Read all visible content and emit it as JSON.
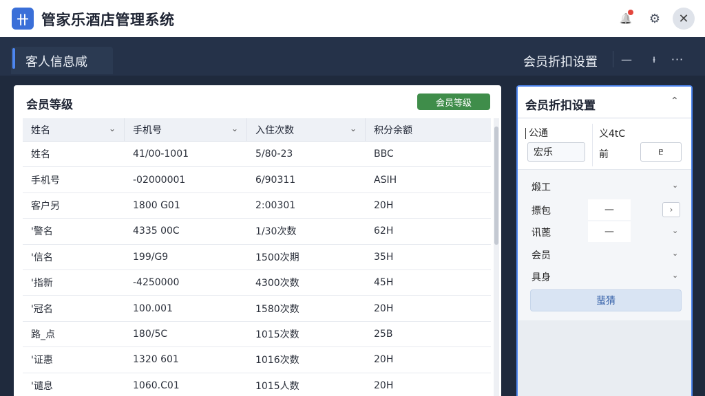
{
  "app": {
    "logo_text": "卄",
    "title": "管家乐酒店管理系统"
  },
  "titlebar": {
    "bell_icon": "bell-icon",
    "gear_icon": "gear-icon",
    "close_icon": "close-icon",
    "bell_glyph": "🔔",
    "gear_glyph": "⚙",
    "close_glyph": "✕"
  },
  "header": {
    "tab_title": "客人信息咸",
    "right_title": "会员折扣设置",
    "min_glyph": "—",
    "pin_glyph": "ᵼ",
    "more_glyph": "···"
  },
  "main": {
    "title": "会员等级",
    "button_label": "会员等级",
    "columns": [
      "姓名",
      "手机号",
      "入住次数",
      "积分余额"
    ],
    "rows": [
      [
        "姓名",
        "41/00-1001",
        "5/80-23",
        "BBC"
      ],
      [
        "手机号",
        "-02000001",
        "6/90311",
        "ASIH"
      ],
      [
        "客户另",
        "1800 G01",
        "2:00301",
        "20H"
      ],
      [
        "'警名",
        "4335 00C",
        "1/30次数",
        "62H"
      ],
      [
        "'信名",
        "199/G9",
        "1500次期",
        "35H"
      ],
      [
        "'指新",
        "-4250000",
        "4300次数",
        "45H"
      ],
      [
        "'冠名",
        "100.001",
        "1580次数",
        "20H"
      ],
      [
        "路_点",
        "180/5C",
        "1015次数",
        "25B"
      ],
      [
        "'证惠",
        "1320 601",
        "1016次数",
        "20H"
      ],
      [
        "'谴息",
        "1060.C01",
        "1015人数",
        "20H"
      ]
    ]
  },
  "side": {
    "title": "会员折扣设置",
    "collapse_glyph": "⌃",
    "field1_label": "公通",
    "field1_value": "宏乐",
    "field2_label": "义4tC",
    "field2_sub": "前",
    "field2_value": "ᥱ",
    "rows": [
      {
        "label": "煅工"
      },
      {
        "label": "摽包"
      },
      {
        "label": "讯蓖"
      },
      {
        "label": "会员"
      },
      {
        "label": "具身"
      }
    ],
    "mini1": "—",
    "mini2": "—",
    "arrow_glyph": "›",
    "confirm_label": "蜚猜"
  }
}
